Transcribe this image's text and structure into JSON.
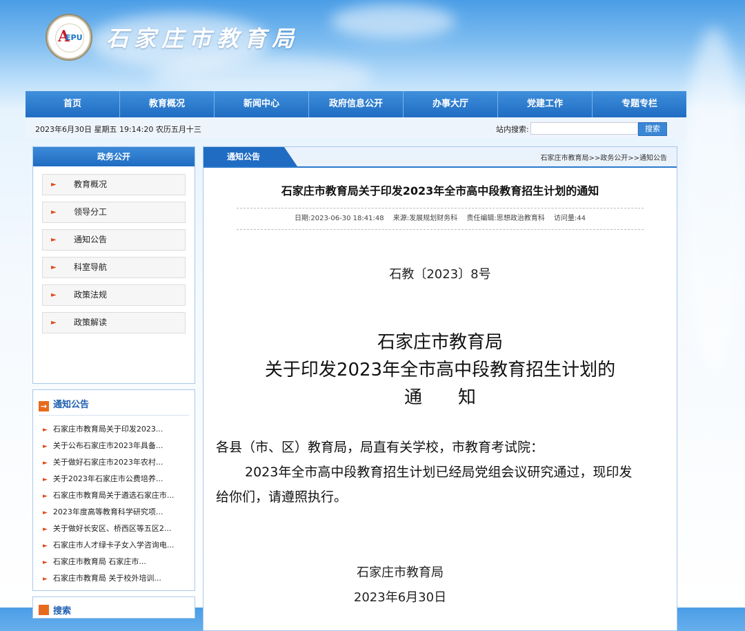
{
  "header": {
    "site_title": "石家庄市教育局"
  },
  "nav": [
    {
      "label": "首页"
    },
    {
      "label": "教育概况"
    },
    {
      "label": "新闻中心"
    },
    {
      "label": "政府信息公开"
    },
    {
      "label": "办事大厅"
    },
    {
      "label": "党建工作"
    },
    {
      "label": "专题专栏"
    }
  ],
  "infobar": {
    "datetime": "2023年6月30日 星期五 19:14:20 农历五月十三",
    "search_label": "站内搜索:",
    "search_value": "",
    "search_button": "搜索"
  },
  "sidebar": {
    "title": "政务公开",
    "menu": [
      {
        "label": "教育概况"
      },
      {
        "label": "领导分工"
      },
      {
        "label": "通知公告"
      },
      {
        "label": "科室导航"
      },
      {
        "label": "政策法规"
      },
      {
        "label": "政策解读"
      }
    ],
    "notice_title": "通知公告",
    "notices": [
      "石家庄市教育局关于印发2023...",
      "关于公布石家庄市2023年具备...",
      "关于做好石家庄市2023年农村...",
      "关于2023年石家庄市公费培养...",
      "石家庄市教育局关于遴选石家庄市...",
      "2023年度高等教育科学研究项...",
      "关于做好长安区、桥西区等五区2...",
      "石家庄市人才绿卡子女入学咨询电...",
      "石家庄市教育局 石家庄市...",
      "石家庄市教育局 关于校外培训..."
    ],
    "search_title": "搜索"
  },
  "main": {
    "tab": "通知公告",
    "breadcrumb": "石家庄市教育局>>政务公开>>通知公告",
    "article_title": "石家庄市教育局关于印发2023年全市高中段教育招生计划的通知",
    "meta": {
      "date": "日期:2023-06-30 18:41:48",
      "source": "来源:发展规划财务科",
      "editor": "责任编辑:思想政治教育科",
      "visits": "访问量:44"
    },
    "doc_number": "石教〔2023〕8号",
    "heading": {
      "line1": "石家庄市教育局",
      "line2": "关于印发2023年全市高中段教育招生计划的",
      "line3": "通　　知"
    },
    "salutation": "各县（市、区）教育局，局直有关学校，市教育考试院：",
    "paragraph_line1": "2023年全市高中段教育招生计划已经局党组会议研究通过，现印发",
    "paragraph_line2": "给你们，请遵照执行。",
    "signature": "石家庄市教育局",
    "sign_date": "2023年6月30日"
  },
  "colors": {
    "nav_blue": "#1f6cc2",
    "accent_orange": "#e04b1c",
    "sky_top": "#4a9de6"
  }
}
